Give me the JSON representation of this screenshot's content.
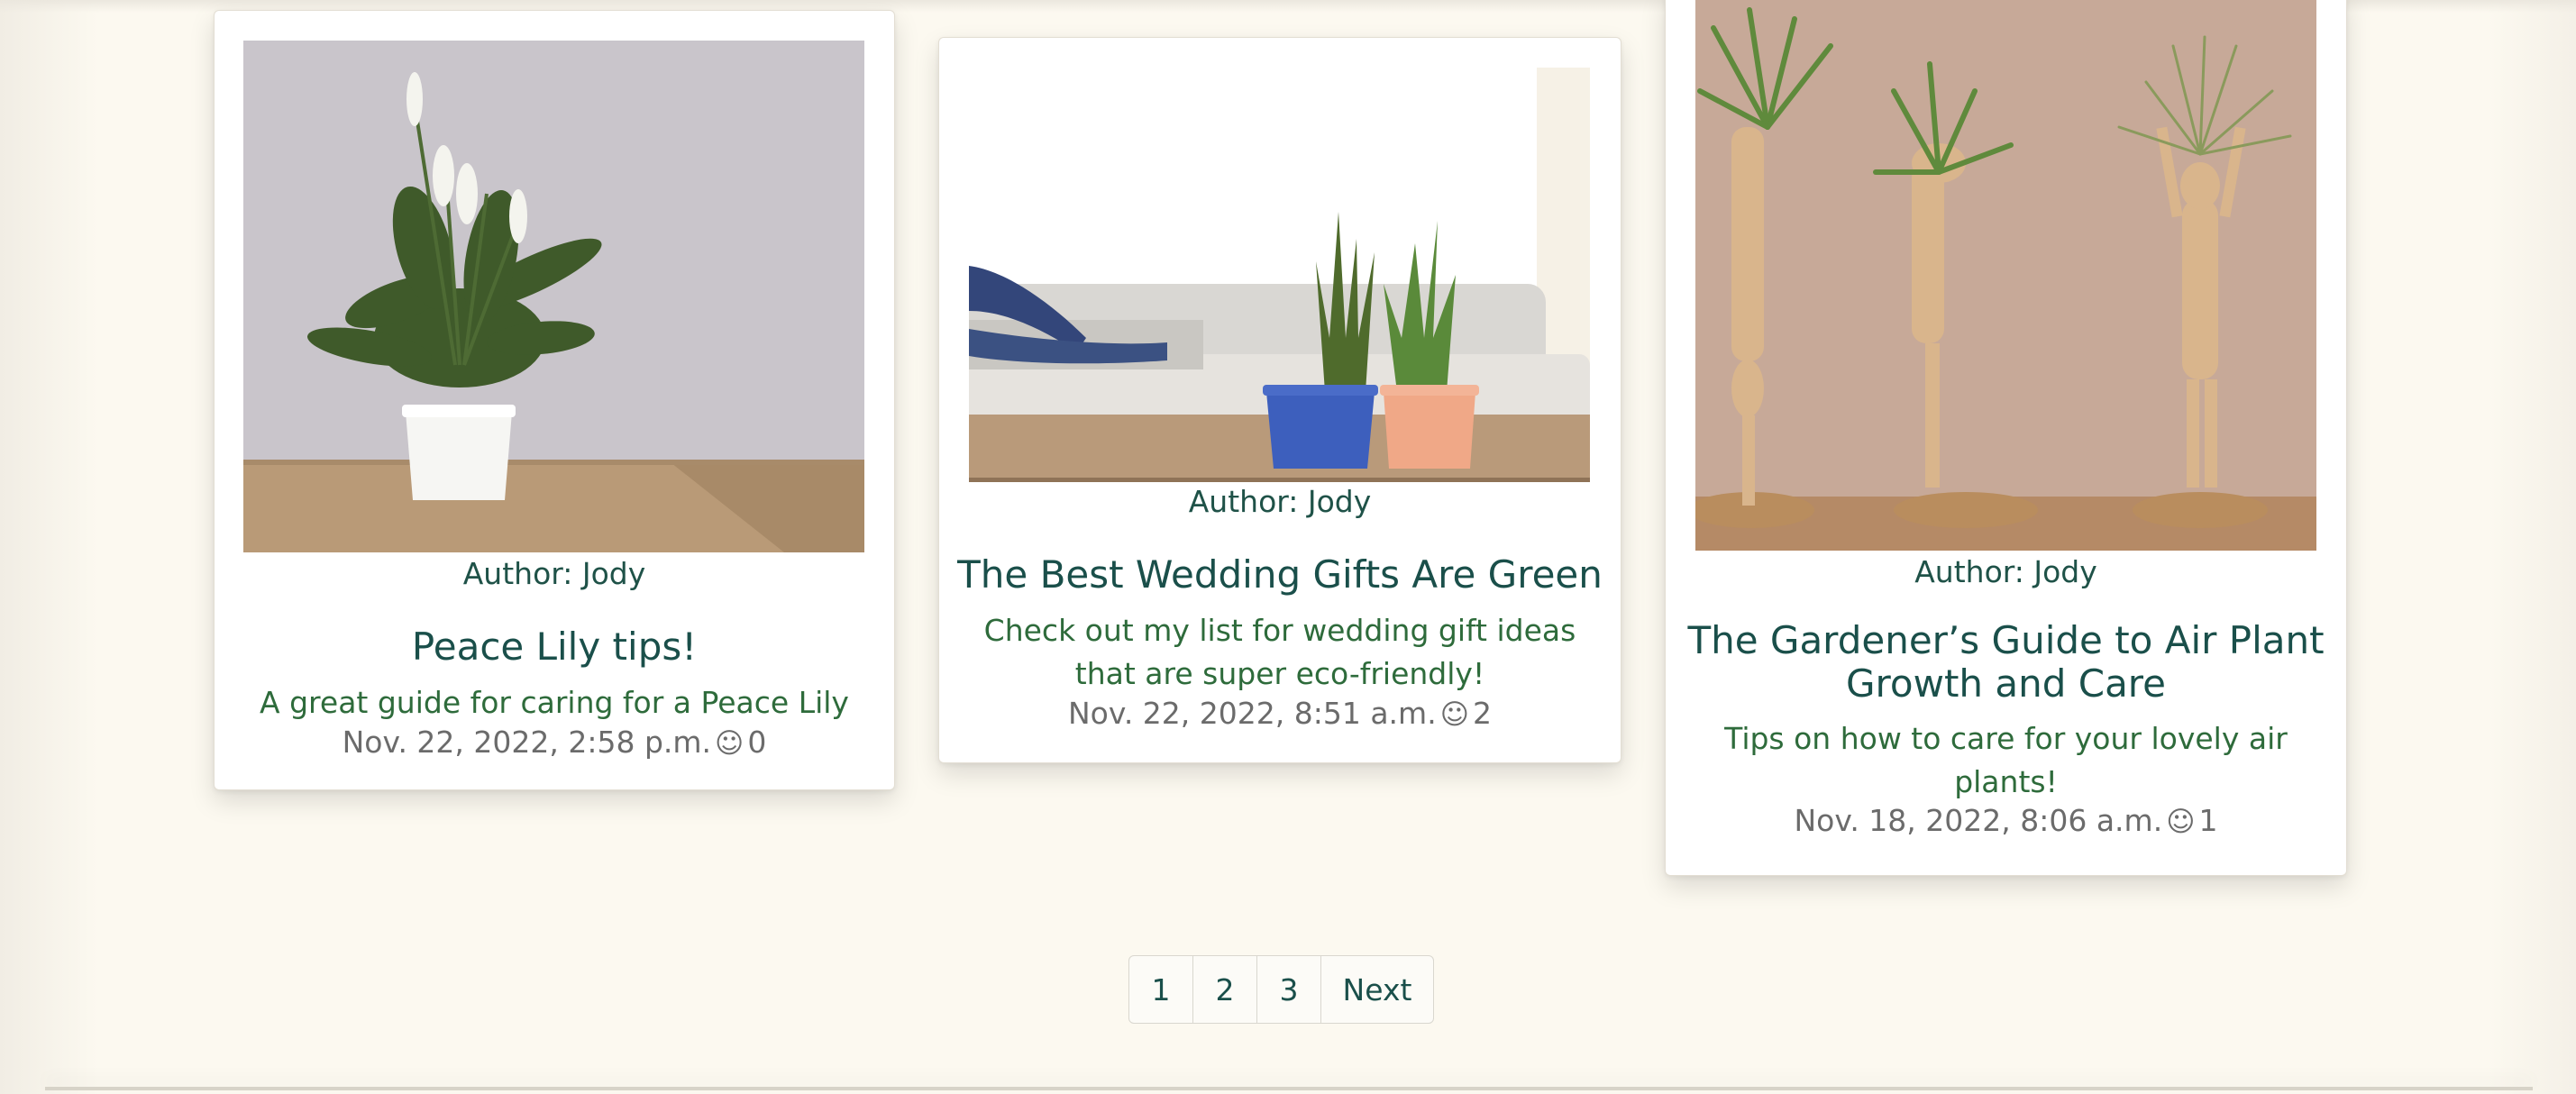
{
  "posts": [
    {
      "author": "Author: Jody",
      "title": "Peace Lily tips!",
      "summary": "A great guide for caring for a Peace Lily",
      "date": "Nov. 22, 2022, 2:58 p.m.",
      "reaction_icon": "smiley-icon",
      "reactions": "0",
      "image": "peace-lily-photo"
    },
    {
      "author": "Author: Jody",
      "title": "The Best Wedding Gifts Are Green",
      "summary": "Check out my list for wedding gift ideas that are super eco-friendly!",
      "date": "Nov. 22, 2022, 8:51 a.m.",
      "reaction_icon": "smiley-icon",
      "reactions": "2",
      "image": "couch-plants-photo"
    },
    {
      "author": "Author: Jody",
      "title": "The Gardener’s Guide to Air Plant Growth and Care",
      "summary": "Tips on how to care for your lovely air plants!",
      "date": "Nov. 18, 2022, 8:06 a.m.",
      "reaction_icon": "smiley-icon",
      "reactions": "1",
      "image": "air-plants-mannequins-photo"
    }
  ],
  "pagination": {
    "pages": [
      "1",
      "2",
      "3"
    ],
    "next": "Next"
  },
  "colors": {
    "background": "#fcf9f0",
    "title": "#1a4f4a",
    "summary": "#2e6b3b",
    "meta": "#6b6b6b"
  }
}
